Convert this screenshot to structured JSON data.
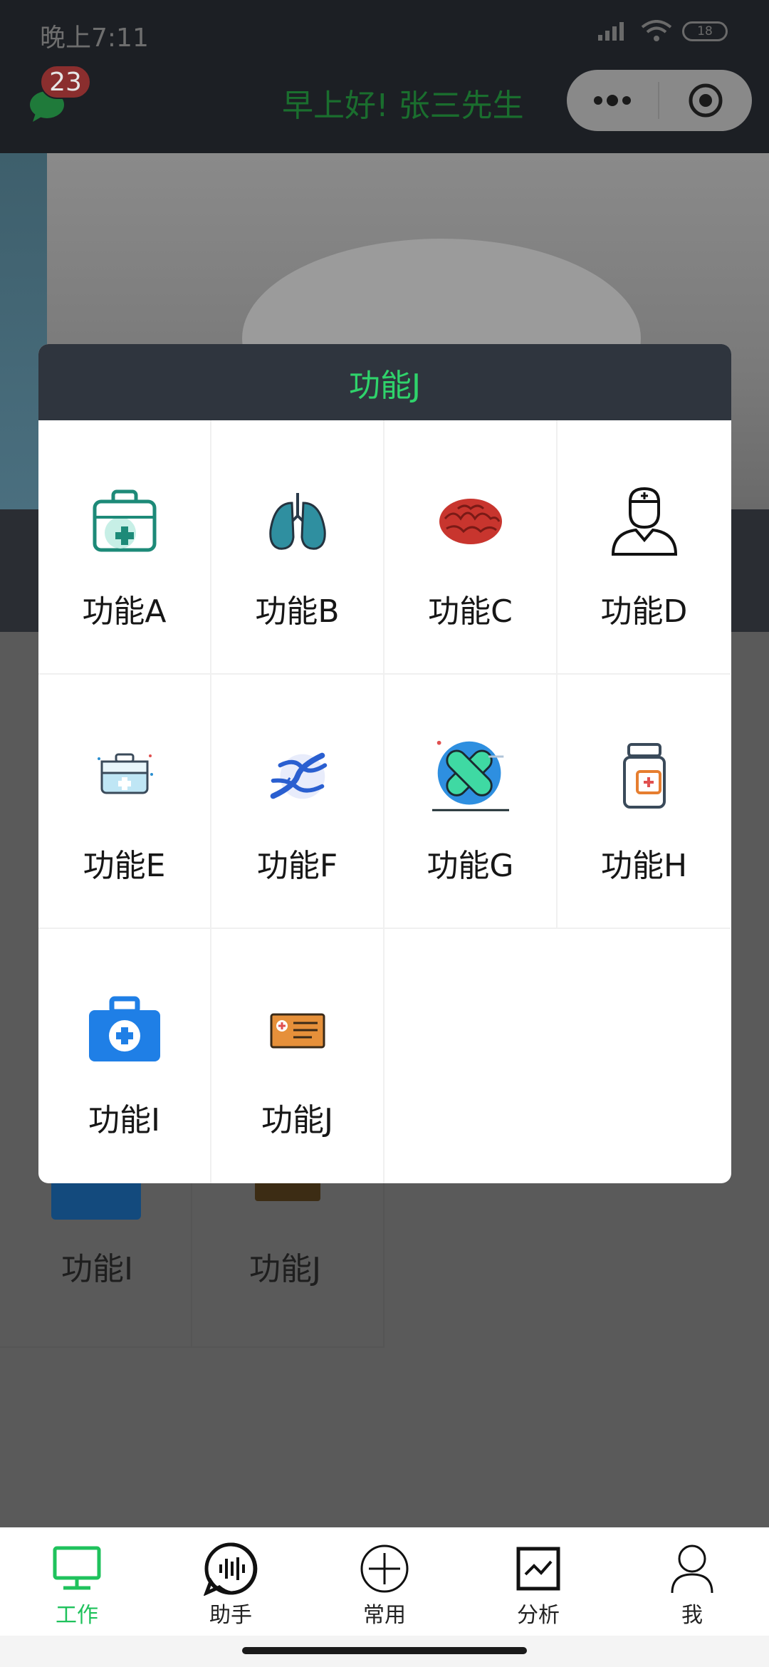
{
  "status": {
    "time": "晚上7:11",
    "battery": "18"
  },
  "header": {
    "badge_count": "23",
    "greeting": "早上好! 张三先生"
  },
  "background": {
    "items": [
      {
        "label": "功能I"
      },
      {
        "label": "功能J"
      }
    ]
  },
  "modal": {
    "title": "功能J",
    "items": [
      {
        "label": "功能A",
        "icon": "medical-kit-icon"
      },
      {
        "label": "功能B",
        "icon": "lungs-icon"
      },
      {
        "label": "功能C",
        "icon": "brain-icon"
      },
      {
        "label": "功能D",
        "icon": "doctor-icon"
      },
      {
        "label": "功能E",
        "icon": "first-aid-box-icon"
      },
      {
        "label": "功能F",
        "icon": "dna-icon"
      },
      {
        "label": "功能G",
        "icon": "bandage-icon"
      },
      {
        "label": "功能H",
        "icon": "medicine-bottle-icon"
      },
      {
        "label": "功能I",
        "icon": "medical-bag-icon"
      },
      {
        "label": "功能J",
        "icon": "medical-card-icon"
      }
    ]
  },
  "tabbar": {
    "active_color": "#1fc25c",
    "items": [
      {
        "label": "工作",
        "icon": "monitor-icon"
      },
      {
        "label": "助手",
        "icon": "voice-assistant-icon"
      },
      {
        "label": "常用",
        "icon": "plus-circle-icon"
      },
      {
        "label": "分析",
        "icon": "chart-icon"
      },
      {
        "label": "我",
        "icon": "user-icon"
      }
    ]
  }
}
